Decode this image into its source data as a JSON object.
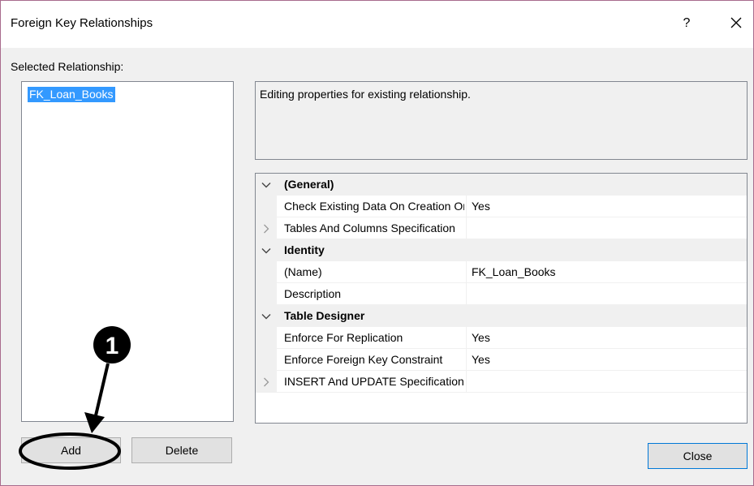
{
  "dialog": {
    "title": "Foreign Key Relationships",
    "help_label": "?",
    "border_color": "#a86b8d"
  },
  "left": {
    "label": "Selected Relationship:",
    "items": [
      "FK_Loan_Books"
    ],
    "selected_color": "#3399ff"
  },
  "description": {
    "text": "Editing properties for existing relationship."
  },
  "grid": {
    "rows": [
      {
        "kind": "category",
        "glyph": "chevron-down-icon",
        "name": "(General)",
        "value": ""
      },
      {
        "kind": "property",
        "glyph": "",
        "name": "Check Existing Data On Creation Or Re-Enabling",
        "value": "Yes"
      },
      {
        "kind": "property",
        "glyph": "chevron-right-icon",
        "name": "Tables And Columns Specification",
        "value": ""
      },
      {
        "kind": "category",
        "glyph": "chevron-down-icon",
        "name": "Identity",
        "value": ""
      },
      {
        "kind": "property",
        "glyph": "",
        "name": "(Name)",
        "value": "FK_Loan_Books"
      },
      {
        "kind": "property",
        "glyph": "",
        "name": "Description",
        "value": ""
      },
      {
        "kind": "category",
        "glyph": "chevron-down-icon",
        "name": "Table Designer",
        "value": ""
      },
      {
        "kind": "property",
        "glyph": "",
        "name": "Enforce For Replication",
        "value": "Yes"
      },
      {
        "kind": "property",
        "glyph": "",
        "name": "Enforce Foreign Key Constraint",
        "value": "Yes"
      },
      {
        "kind": "property",
        "glyph": "chevron-right-icon",
        "name": "INSERT And UPDATE Specification",
        "value": ""
      }
    ]
  },
  "buttons": {
    "add": "Add",
    "delete": "Delete",
    "close": "Close"
  },
  "annotation": {
    "step_number": "1",
    "color": "#000000"
  }
}
